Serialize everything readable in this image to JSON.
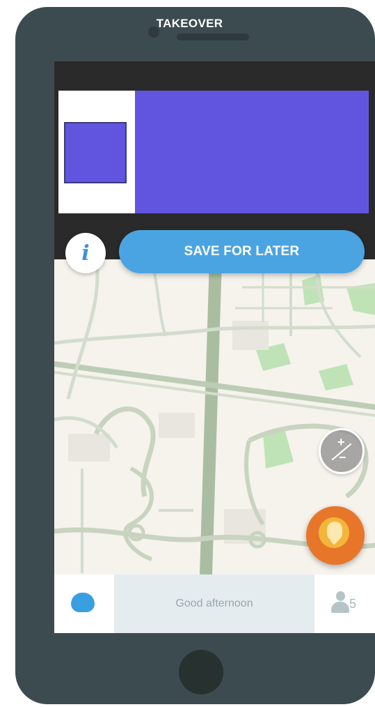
{
  "device": {
    "label": "TAKEOVER"
  },
  "ad": {
    "small_color": "#6155e0",
    "large_color": "#6155e0"
  },
  "actions": {
    "info_label": "i",
    "save_label": "SAVE FOR LATER"
  },
  "map_controls": {
    "zoom_in_label": "+",
    "zoom_out_label": "−",
    "report_icon": "report-pin-icon"
  },
  "bottom_bar": {
    "status_text": "Good afternoon",
    "friends_count": "5",
    "menu_icon": "waze-icon",
    "friends_icon": "person-icon"
  },
  "colors": {
    "phone": "#3c4b50",
    "accent_blue": "#4aa4e2",
    "report_orange": "#e8762a",
    "ad_purple": "#6155e0",
    "map_background": "#f5f3ec"
  }
}
